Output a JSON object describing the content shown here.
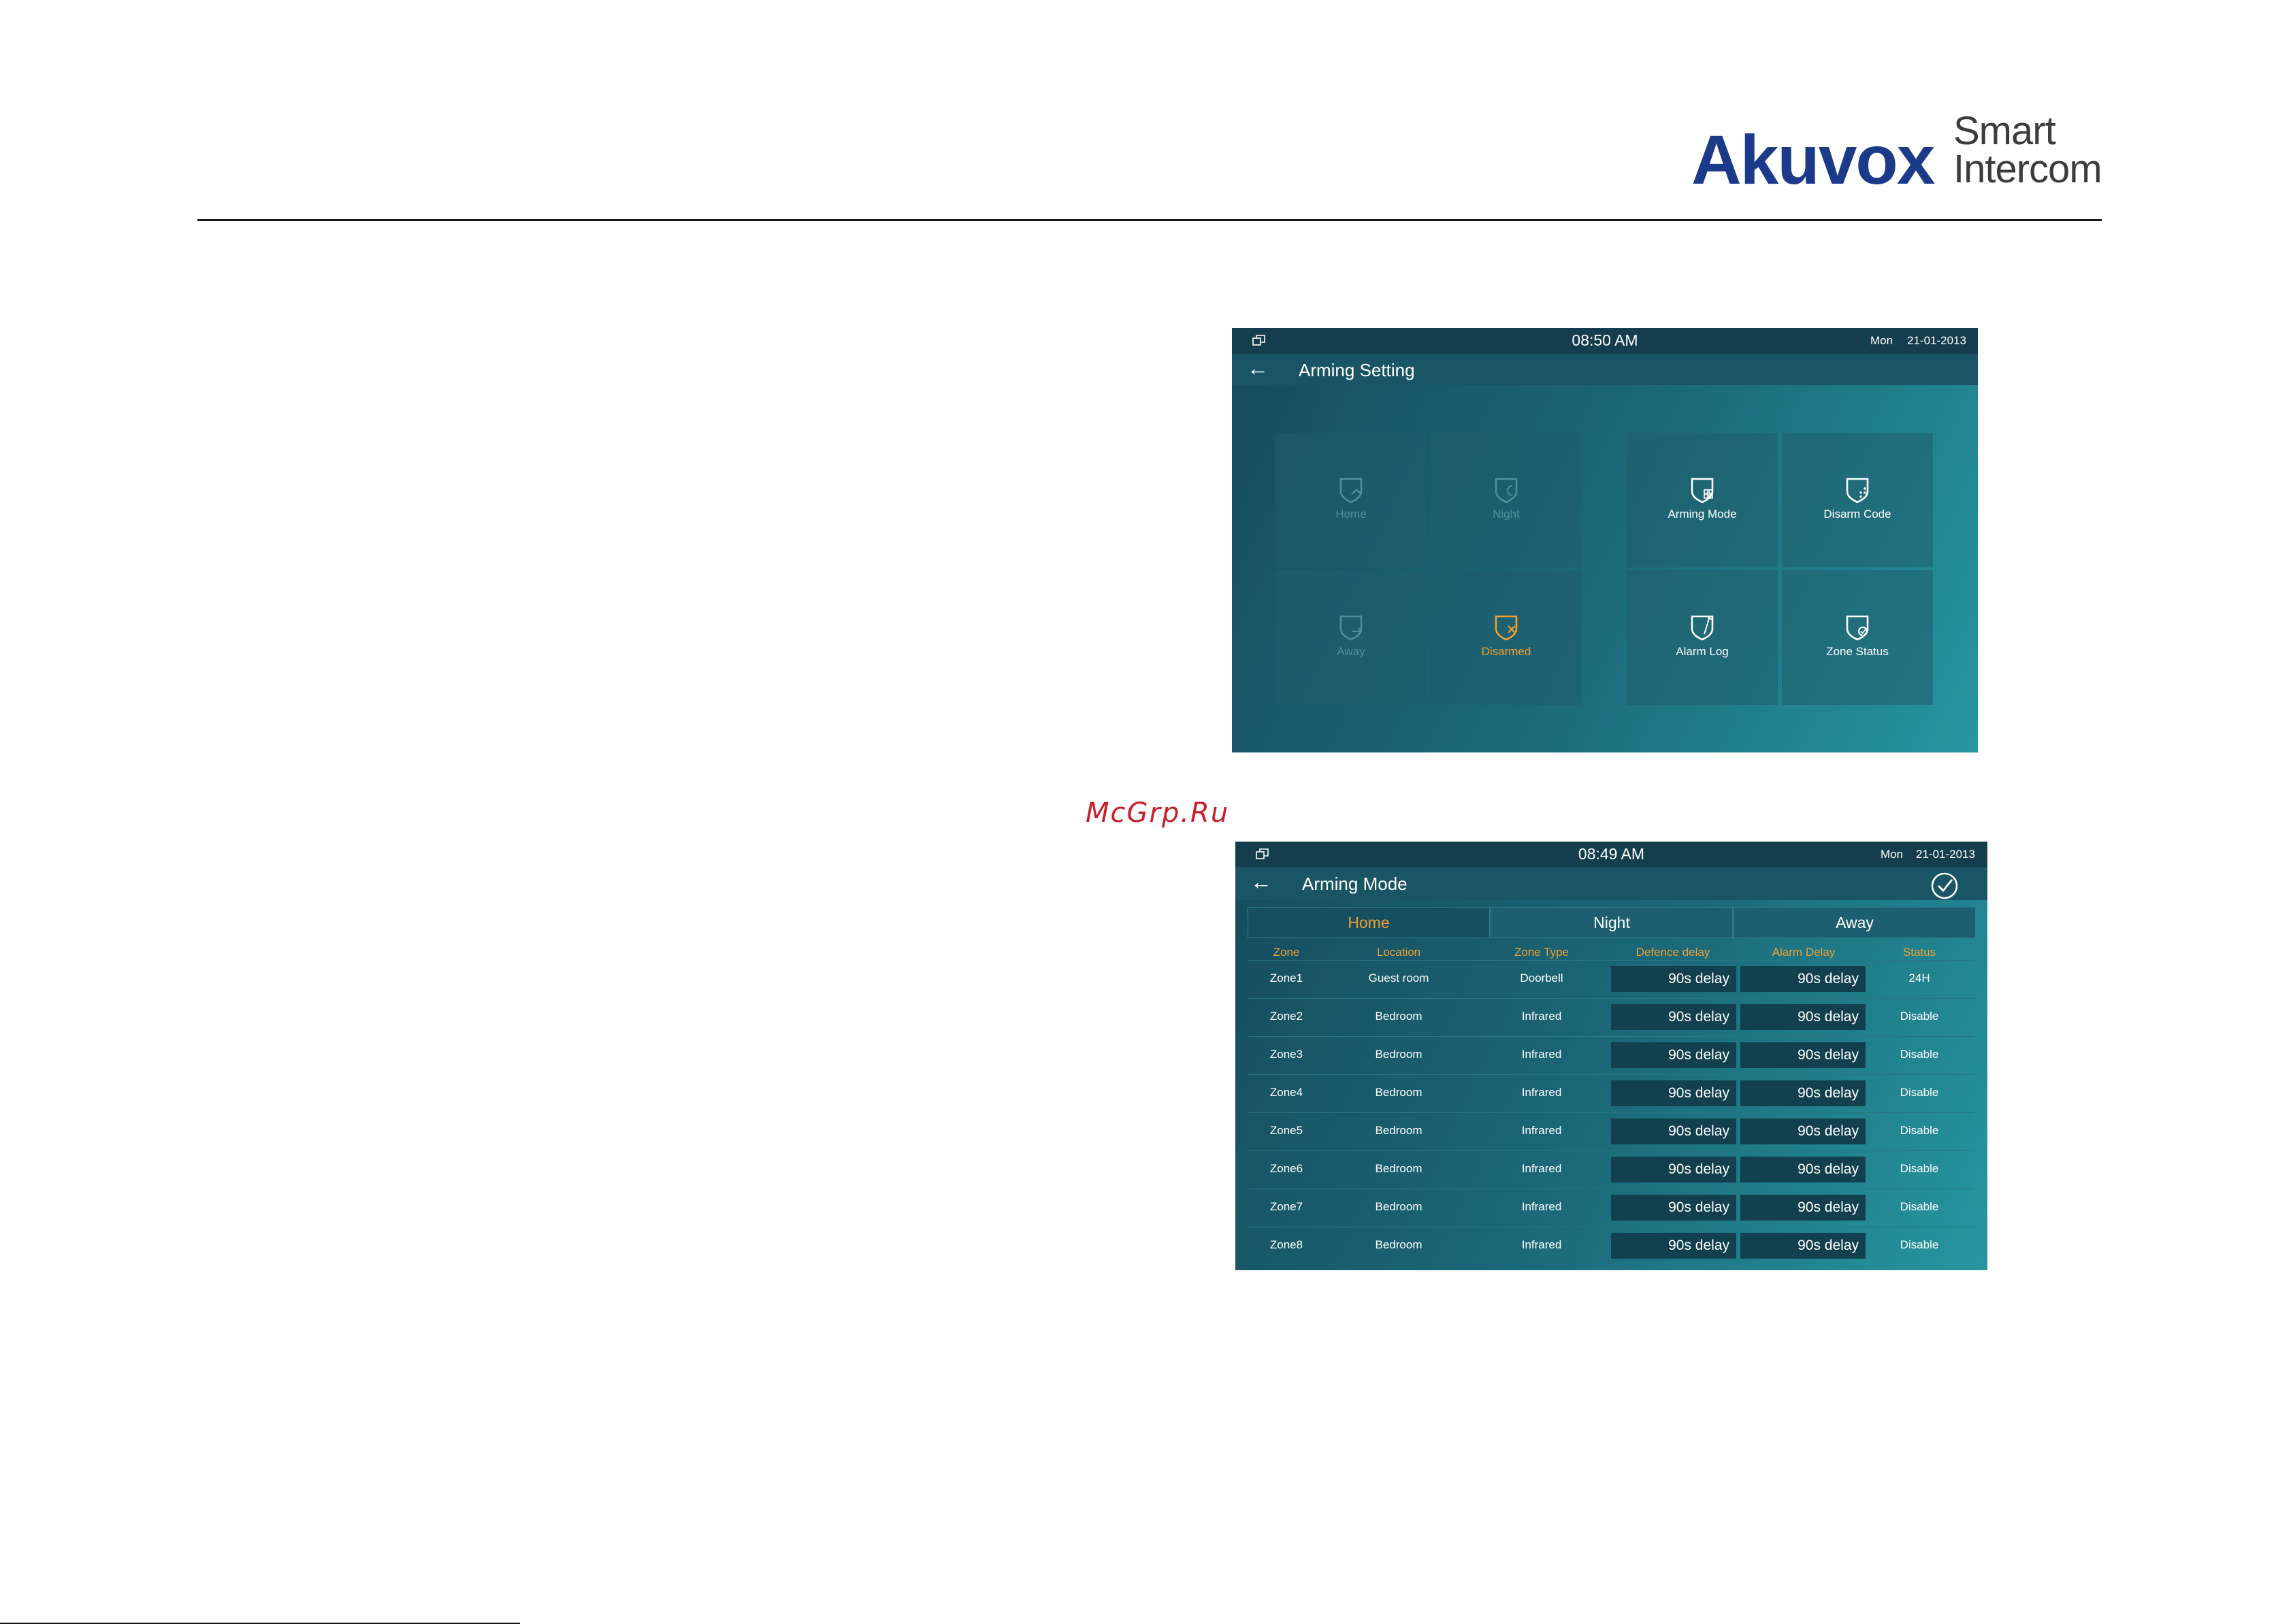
{
  "brand": {
    "name": "Akuvox",
    "tagline_line1": "Smart",
    "tagline_line2": "Intercom",
    "color": "#1b3a8a"
  },
  "watermark": "McGrp.Ru",
  "screen1": {
    "status": {
      "time": "08:50 AM",
      "day": "Mon",
      "date": "21-01-2013"
    },
    "title": "Arming Setting",
    "tiles": [
      {
        "label": "Home",
        "icon": "home-shield-icon",
        "state": "dim"
      },
      {
        "label": "Night",
        "icon": "night-shield-icon",
        "state": "dim"
      },
      {
        "label": "Away",
        "icon": "away-shield-icon",
        "state": "dim"
      },
      {
        "label": "Disarmed",
        "icon": "disarmed-shield-icon",
        "state": "active"
      },
      {
        "label": "Arming Mode",
        "icon": "arming-mode-shield-icon",
        "state": "normal"
      },
      {
        "label": "Disarm Code",
        "icon": "disarm-code-shield-icon",
        "state": "normal"
      },
      {
        "label": "Alarm Log",
        "icon": "alarm-log-shield-icon",
        "state": "normal"
      },
      {
        "label": "Zone Status",
        "icon": "zone-status-shield-icon",
        "state": "normal"
      }
    ]
  },
  "screen2": {
    "status": {
      "time": "08:49 AM",
      "day": "Mon",
      "date": "21-01-2013"
    },
    "title": "Arming Mode",
    "tabs": [
      "Home",
      "Night",
      "Away"
    ],
    "active_tab": "Home",
    "columns": [
      "Zone",
      "Location",
      "Zone Type",
      "Defence delay",
      "Alarm Delay",
      "Status"
    ],
    "rows": [
      [
        "Zone1",
        "Guest room",
        "Doorbell",
        "90s delay",
        "90s delay",
        "24H"
      ],
      [
        "Zone2",
        "Bedroom",
        "Infrared",
        "90s delay",
        "90s delay",
        "Disable"
      ],
      [
        "Zone3",
        "Bedroom",
        "Infrared",
        "90s delay",
        "90s delay",
        "Disable"
      ],
      [
        "Zone4",
        "Bedroom",
        "Infrared",
        "90s delay",
        "90s delay",
        "Disable"
      ],
      [
        "Zone5",
        "Bedroom",
        "Infrared",
        "90s delay",
        "90s delay",
        "Disable"
      ],
      [
        "Zone6",
        "Bedroom",
        "Infrared",
        "90s delay",
        "90s delay",
        "Disable"
      ],
      [
        "Zone7",
        "Bedroom",
        "Infrared",
        "90s delay",
        "90s delay",
        "Disable"
      ],
      [
        "Zone8",
        "Bedroom",
        "Infrared",
        "90s delay",
        "90s delay",
        "Disable"
      ]
    ]
  },
  "colors": {
    "accent": "#f0a033",
    "dim_label": "#4f8f99",
    "panel": "#1b6878"
  }
}
